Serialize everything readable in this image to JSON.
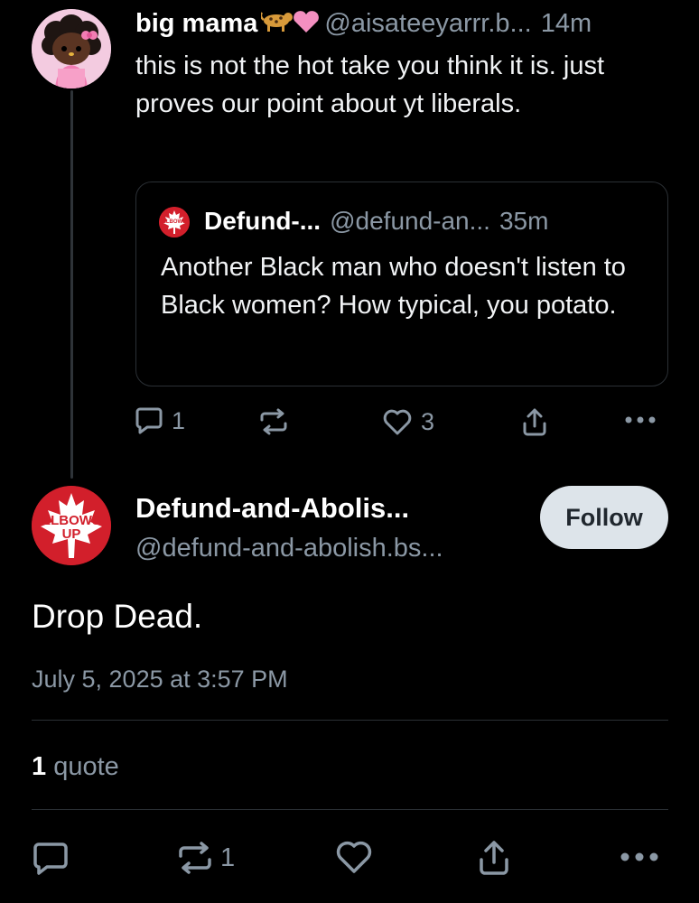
{
  "parent_post": {
    "author_name": "big mama",
    "author_emoji": "🐆🩷",
    "handle": "@aisateeyarrr.b...",
    "time": "14m",
    "text": "this is not the hot take you think it is. just proves our point about yt liberals.",
    "quoted_post": {
      "author_name": "Defund-...",
      "handle": "@defund-an...",
      "time": "35m",
      "text": "Another Black man who doesn't listen to Black women? How typical, you potato.",
      "avatar_icon": "elbows-up-maple-leaf-icon"
    },
    "actions": {
      "reply_count": "1",
      "repost_count": "",
      "like_count": "3"
    }
  },
  "main_post": {
    "author_name": "Defund-and-Abolis...",
    "handle": "@defund-and-abolish.bs...",
    "follow_label": "Follow",
    "avatar_text_top": "ELBOWS",
    "avatar_text_bottom": "UP",
    "text": "Drop Dead.",
    "date": "July 5, 2025 at 3:57 PM",
    "quote_count": "1",
    "quote_label": "quote",
    "actions": {
      "reply_count": "",
      "repost_count": "1",
      "like_count": ""
    }
  },
  "colors": {
    "background": "#000000",
    "text": "#f1f3f5",
    "muted": "#8b98a5",
    "border": "#2b3035",
    "follow_bg": "#dde4ea",
    "avatar_red": "#d21f2b"
  }
}
